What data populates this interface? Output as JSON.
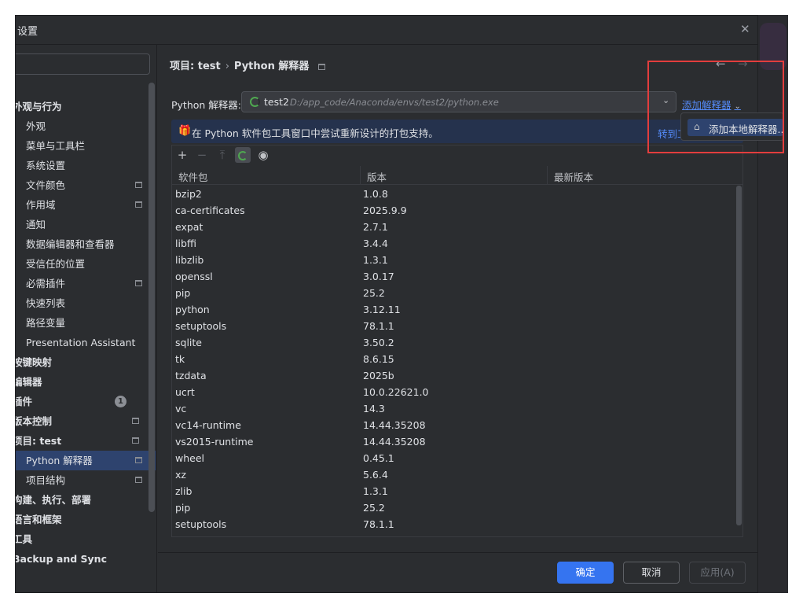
{
  "window": {
    "title": "设置"
  },
  "sidebar": {
    "items": [
      {
        "label": "外观与行为",
        "level": 0
      },
      {
        "label": "外观",
        "level": 1
      },
      {
        "label": "菜单与工具栏",
        "level": 1
      },
      {
        "label": "系统设置",
        "level": 1
      },
      {
        "label": "文件颜色",
        "level": 1,
        "icon": "project-scope-icon"
      },
      {
        "label": "作用域",
        "level": 1,
        "icon": "project-scope-icon"
      },
      {
        "label": "通知",
        "level": 1
      },
      {
        "label": "数据编辑器和查看器",
        "level": 1
      },
      {
        "label": "受信任的位置",
        "level": 1
      },
      {
        "label": "必需插件",
        "level": 1,
        "icon": "project-scope-icon"
      },
      {
        "label": "快速列表",
        "level": 1
      },
      {
        "label": "路径变量",
        "level": 1
      },
      {
        "label": "Presentation Assistant",
        "level": 1
      },
      {
        "label": "按键映射",
        "level": 0
      },
      {
        "label": "编辑器",
        "level": 0
      },
      {
        "label": "插件",
        "level": 0,
        "badge": "1"
      },
      {
        "label": "版本控制",
        "level": 0,
        "icon": "project-scope-icon"
      },
      {
        "label": "项目: test",
        "level": 0,
        "icon": "project-scope-icon"
      },
      {
        "label": "Python 解释器",
        "level": 1,
        "icon": "project-scope-icon",
        "selected": true
      },
      {
        "label": "项目结构",
        "level": 1,
        "icon": "project-scope-icon"
      },
      {
        "label": "构建、执行、部署",
        "level": 0
      },
      {
        "label": "语言和框架",
        "level": 0
      },
      {
        "label": "工具",
        "level": 0
      },
      {
        "label": "Backup and Sync",
        "level": 0
      }
    ]
  },
  "breadcrumb": {
    "project": "项目: test",
    "separator": "›",
    "page": "Python 解释器"
  },
  "interpreter": {
    "label": "Python 解释器:",
    "name": "test2",
    "path": "D:/app_code/Anaconda/envs/test2/python.exe",
    "add_link": "添加解释器"
  },
  "banner": {
    "text": "在 Python 软件包工具窗口中尝试重新设计的打包支持。",
    "link": "转到工"
  },
  "packages": {
    "toolbar": [
      "plus-icon",
      "minus-icon",
      "upgrade-icon",
      "refresh-icon",
      "eye-icon"
    ],
    "columns": [
      "软件包",
      "版本",
      "最新版本"
    ],
    "rows": [
      [
        "bzip2",
        "1.0.8"
      ],
      [
        "ca-certificates",
        "2025.9.9"
      ],
      [
        "expat",
        "2.7.1"
      ],
      [
        "libffi",
        "3.4.4"
      ],
      [
        "libzlib",
        "1.3.1"
      ],
      [
        "openssl",
        "3.0.17"
      ],
      [
        "pip",
        "25.2"
      ],
      [
        "python",
        "3.12.11"
      ],
      [
        "setuptools",
        "78.1.1"
      ],
      [
        "sqlite",
        "3.50.2"
      ],
      [
        "tk",
        "8.6.15"
      ],
      [
        "tzdata",
        "2025b"
      ],
      [
        "ucrt",
        "10.0.22621.0"
      ],
      [
        "vc",
        "14.3"
      ],
      [
        "vc14-runtime",
        "14.44.35208"
      ],
      [
        "vs2015-runtime",
        "14.44.35208"
      ],
      [
        "wheel",
        "0.45.1"
      ],
      [
        "xz",
        "5.6.4"
      ],
      [
        "zlib",
        "1.3.1"
      ],
      [
        "pip",
        "25.2"
      ],
      [
        "setuptools",
        "78.1.1"
      ]
    ]
  },
  "popup": {
    "item": "添加本地解释器..."
  },
  "footer": {
    "ok": "确定",
    "cancel": "取消",
    "apply": "应用(A)"
  },
  "colors": {
    "accent": "#3574f0",
    "link": "#548af7",
    "selection": "#2e436e",
    "highlight_box": "#e23d3d",
    "spinner": "#4fa850"
  }
}
